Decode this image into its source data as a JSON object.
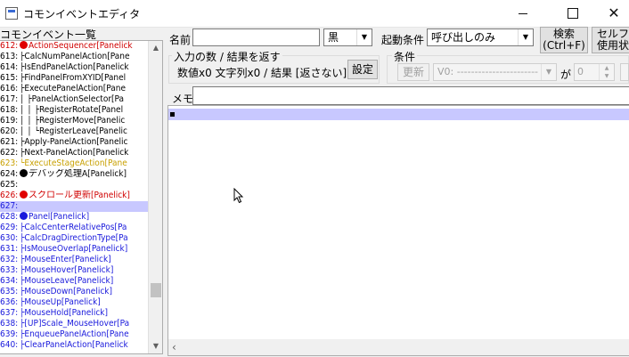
{
  "window": {
    "title": "コモンイベントエディタ",
    "minimize": "",
    "maximize": "",
    "close": "✕"
  },
  "list": {
    "label": "コモンイベント一覧",
    "items": [
      {
        "n": "612:",
        "t": "ActionSequencer[Panelick",
        "c": "red",
        "dot": "#e00000"
      },
      {
        "n": "613:",
        "t": "├CalcNumPanelAction[Pane",
        "c": "black"
      },
      {
        "n": "614:",
        "t": "├IsEndPanelAction[Panelick",
        "c": "black"
      },
      {
        "n": "615:",
        "t": "├FindPanelFromXYID[Panel",
        "c": "black"
      },
      {
        "n": "616:",
        "t": "├ExecutePanelAction[Pane",
        "c": "black"
      },
      {
        "n": "617:",
        "t": "│ ├PanelActionSelector[Pa",
        "c": "black"
      },
      {
        "n": "618:",
        "t": "│ │ ├RegisterRotate[Panel",
        "c": "black"
      },
      {
        "n": "619:",
        "t": "│ │ ├RegisterMove[Panelic",
        "c": "black"
      },
      {
        "n": "620:",
        "t": "│ │ └RegisterLeave[Panelic",
        "c": "black"
      },
      {
        "n": "621:",
        "t": "├Apply-PanelAction[Panelic",
        "c": "black"
      },
      {
        "n": "622:",
        "t": "├Next-PanelAction[Panelick",
        "c": "black"
      },
      {
        "n": "623:",
        "t": "└ExecuteStageAction[Pane",
        "c": "yellow"
      },
      {
        "n": "624:",
        "t": "デバッグ処理A[Panelick]",
        "c": "black",
        "dot": "#000000"
      },
      {
        "n": "625:",
        "t": "",
        "c": "black"
      },
      {
        "n": "626:",
        "t": "スクロール更新[Panelick]",
        "c": "red",
        "dot": "#e00000"
      },
      {
        "n": "627:",
        "t": "",
        "c": "blue",
        "sel": true
      },
      {
        "n": "628:",
        "t": "Panel[Panelick]",
        "c": "blue",
        "dot": "#1a1adc"
      },
      {
        "n": "629:",
        "t": "├CalcCenterRelativePos[Pa",
        "c": "blue"
      },
      {
        "n": "630:",
        "t": "├CalcDragDirectionType[Pa",
        "c": "blue"
      },
      {
        "n": "631:",
        "t": "├IsMouseOverlap[Panelick]",
        "c": "blue"
      },
      {
        "n": "632:",
        "t": "├MouseEnter[Panelick]",
        "c": "blue"
      },
      {
        "n": "633:",
        "t": "├MouseHover[Panelick]",
        "c": "blue"
      },
      {
        "n": "634:",
        "t": "├MouseLeave[Panelick]",
        "c": "blue"
      },
      {
        "n": "635:",
        "t": "├MouseDown[Panelick]",
        "c": "blue"
      },
      {
        "n": "636:",
        "t": "├MouseUp[Panelick]",
        "c": "blue"
      },
      {
        "n": "637:",
        "t": "├MouseHold[Panelick]",
        "c": "blue"
      },
      {
        "n": "638:",
        "t": "├[UP]Scale_MouseHover[Pa",
        "c": "blue"
      },
      {
        "n": "639:",
        "t": "├EnqueuePanelAction[Pane",
        "c": "blue"
      },
      {
        "n": "640:",
        "t": "├ClearPanelAction[Panelick",
        "c": "blue"
      }
    ]
  },
  "form": {
    "name_label": "名前",
    "name_value": "",
    "color_value": "黒",
    "trigger_label": "起動条件",
    "trigger_value": "呼び出しのみ",
    "search_label_1": "検索",
    "search_label_2": "(Ctrl+F)",
    "self_var_label_1": "セルフ変",
    "self_var_label_2": "使用状",
    "io_group_title": "入力の数 / 結果を返す",
    "io_summary": "数値x0 文字列x0 / 結果 [返さない]",
    "io_settings_button": "設定",
    "cond_group_title": "条件",
    "cond_update_button": "更新",
    "cond_var_value": "V0: -----------------------",
    "cond_ga": "が",
    "cond_num_value": "0",
    "memo_label": "メモ",
    "memo_value": ""
  },
  "colors": {
    "selection": "#c8c8ff",
    "red": "#d00000",
    "blue": "#1a1adc",
    "yellow": "#c8a000"
  }
}
